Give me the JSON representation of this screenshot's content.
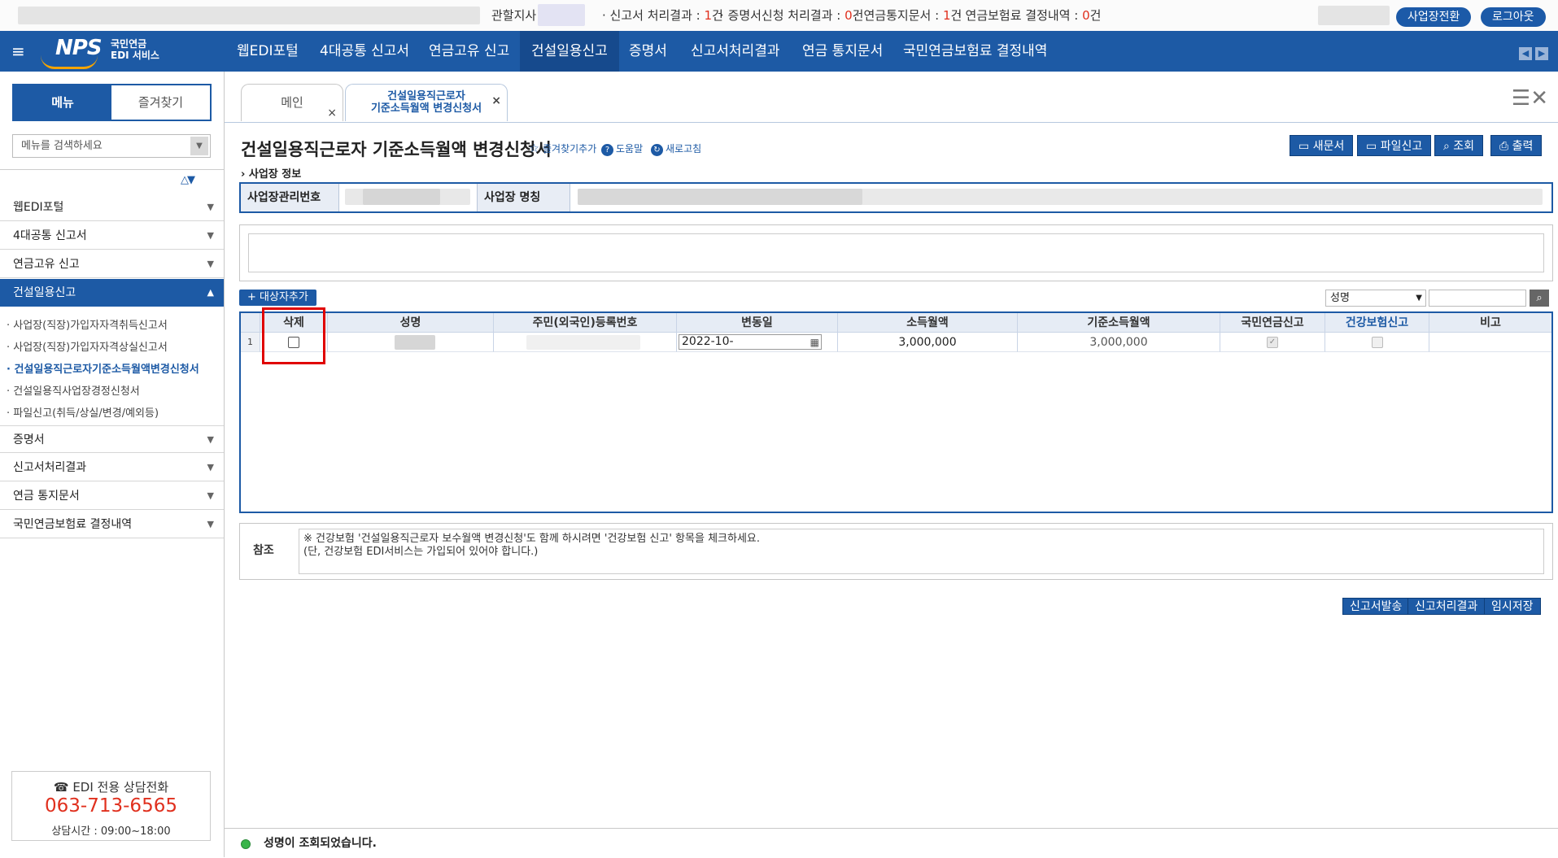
{
  "topbar": {
    "branch_label": "관할지사 :",
    "stats": [
      {
        "label": "· 신고서 처리결과 : ",
        "count": "1",
        "unit": "건"
      },
      {
        "label": "· 증명서신청 처리결과 : ",
        "count": "0",
        "unit": "건"
      },
      {
        "label": "· 연금통지문서 : ",
        "count": "1",
        "unit": "건"
      },
      {
        "label": "· 연금보험료 결정내역 : ",
        "count": "0",
        "unit": "건"
      }
    ],
    "switch_btn": "사업장전환",
    "logout_btn": "로그아웃"
  },
  "logo": {
    "brand": "NPS",
    "line1": "국민연금",
    "line2": "EDI 서비스"
  },
  "nav": [
    "웹EDI포털",
    "4대공통 신고서",
    "연금고유 신고",
    "건설일용신고",
    "증명서",
    "신고서처리결과",
    "연금 통지문서",
    "국민연금보험료 결정내역"
  ],
  "sidebar": {
    "tab_menu": "메뉴",
    "tab_fav": "즐겨찾기",
    "search_placeholder": "메뉴를 검색하세요",
    "menus_top": [
      "웹EDI포털",
      "4대공통 신고서",
      "연금고유 신고",
      "건설일용신고"
    ],
    "subitems": [
      "· 사업장(직장)가입자자격취득신고서",
      "· 사업장(직장)가입자자격상실신고서",
      "· 건설일용직근로자기준소득월액변경신청서",
      "· 건설일용직사업장경정신청서",
      "· 파일신고(취득/상실/변경/예외등)"
    ],
    "menus_bottom": [
      "증명서",
      "신고서처리결과",
      "연금 통지문서",
      "국민연금보험료 결정내역"
    ],
    "phone_title": "☎ EDI 전용 상담전화",
    "phone_number": "063-713-6565",
    "phone_hours": "상담시간 : 09:00~18:00"
  },
  "tabs": {
    "main": "메인",
    "active_line1": "건설일용직근로자",
    "active_line2": "기준소득월액 변경신청서",
    "close": "×"
  },
  "page": {
    "title": "건설일용직근로자 기준소득월액 변경신청서",
    "fav_link": "즐겨찾기추가",
    "help_link": "도움말",
    "refresh_link": "새로고침",
    "buttons": [
      "새문서",
      "파일신고",
      "조회",
      "출력"
    ],
    "section": "사업장 정보",
    "biz_no_label": "사업장관리번호",
    "biz_name_label": "사업장 명칭"
  },
  "grid": {
    "add_btn": "+ 대상자추가",
    "search_select": "성명",
    "headers": [
      "삭제",
      "성명",
      "주민(외국인)등록번호",
      "변동일",
      "소득월액",
      "기준소득월액",
      "국민연금신고",
      "건강보험신고",
      "비고"
    ],
    "rows": [
      {
        "num": "1",
        "date": "2022-10-",
        "income": "3,000,000",
        "base_income": "3,000,000",
        "pension_checked": "✓"
      }
    ]
  },
  "note": {
    "label": "참조",
    "line1": "※ 건강보험 '건설일용직근로자 보수월액 변경신청'도 함께 하시려면 '건강보험 신고' 항목을 체크하세요.",
    "line2": "(단, 건강보험 EDI서비스는 가입되어 있어야 합니다.)"
  },
  "bottom_buttons": [
    "신고서발송",
    "신고처리결과",
    "임시저장"
  ],
  "status": "성명이 조회되었습니다."
}
